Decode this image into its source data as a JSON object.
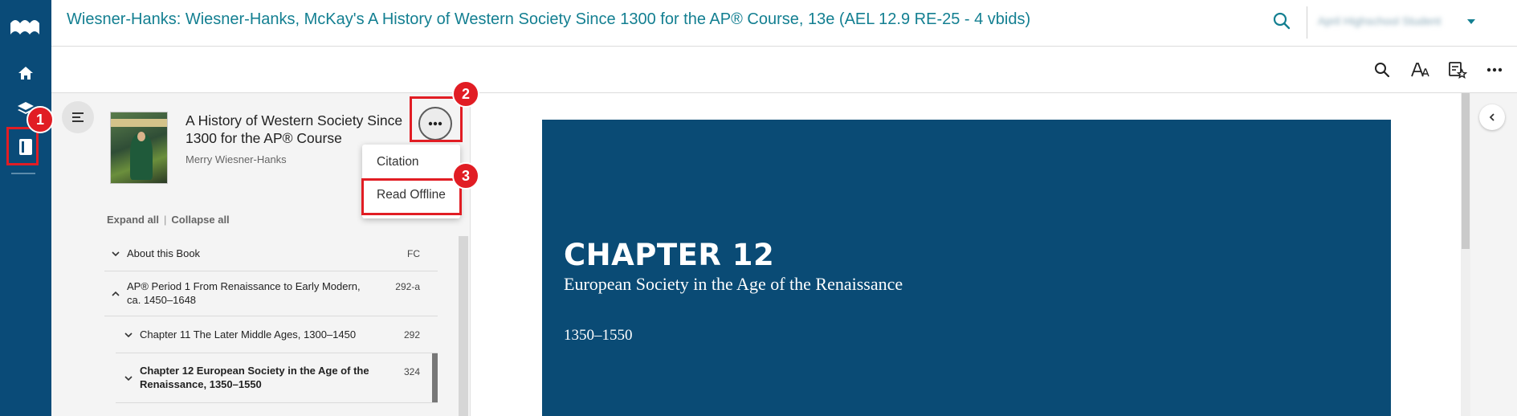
{
  "header": {
    "title": "Wiesner-Hanks: Wiesner-Hanks, McKay's A History of Western Society Since 1300 for the AP® Course, 13e (AEL 12.9 RE-25 - 4 vbids)",
    "user_name": "April Highschool Student"
  },
  "book": {
    "title": "A History of Western Society Since 1300 for the AP® Course",
    "author": "Merry Wiesner-Hanks"
  },
  "toc_controls": {
    "expand_all": "Expand all",
    "collapse_all": "Collapse all"
  },
  "toc": [
    {
      "label": "About this Book",
      "page": "FC"
    },
    {
      "label": "AP® Period 1 From Renaissance to Early Modern, ca. 1450–1648",
      "page": "292-a"
    },
    {
      "label": "Chapter 11 The Later Middle Ages, 1300–1450",
      "page": "292"
    },
    {
      "label": "Chapter 12 European Society in the Age of the Renaissance, 1350–1550",
      "page": "324"
    }
  ],
  "menu": {
    "citation": "Citation",
    "read_offline": "Read Offline"
  },
  "badges": [
    "1",
    "2",
    "3"
  ],
  "content": {
    "chapter": "CHAPTER 12",
    "subtitle": "European Society in the Age of the Renaissance",
    "dates": "1350–1550"
  },
  "colors": {
    "rail": "#0a4b78",
    "title": "#137f91",
    "highlight": "#e11d24",
    "chapter_block": "#0a4b75"
  }
}
